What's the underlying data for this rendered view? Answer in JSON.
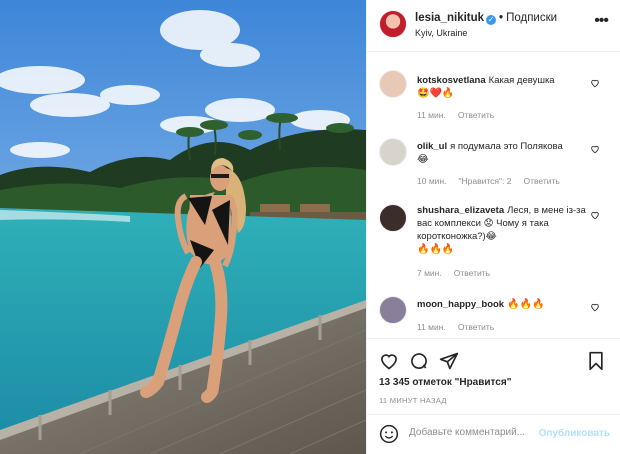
{
  "header": {
    "username": "lesia_nikituk",
    "separator": "•",
    "follow_label": "Подписки",
    "location": "Kyiv, Ukraine",
    "more_label": "•••"
  },
  "comments": [
    {
      "username": "kotskosvetlana",
      "text": "Какая девушка",
      "emojis": "🤩❤️🔥",
      "time": "11 мин.",
      "reply": "Ответить",
      "avatar_color": "#e8c9b6"
    },
    {
      "username": "olik_ul",
      "text": "я подумала это Полякова",
      "emojis": "😂",
      "time": "10 мин.",
      "likes": "\"Нравится\": 2",
      "reply": "Ответить",
      "avatar_color": "#d8d4cc"
    },
    {
      "username": "shushara_elizaveta",
      "text": "Леся, в мене із-за вас комплекси 😟 Чому я така коротконожка?)😂",
      "emojis": "🔥🔥🔥",
      "time": "7 мин.",
      "reply": "Ответить",
      "avatar_color": "#3b2e2a"
    },
    {
      "username": "moon_happy_book",
      "text": "",
      "emojis": "🔥🔥🔥",
      "time": "11 мин.",
      "reply": "Ответить",
      "avatar_color": "#8a7f9a"
    }
  ],
  "stats": {
    "likes": "13 345 отметок \"Нравится\"",
    "time_ago": "11 МИНУТ НАЗАД"
  },
  "add_comment": {
    "placeholder": "Добавьте комментарий...",
    "publish_label": "Опубликовать"
  },
  "colors": {
    "link_blue": "#3897f0",
    "publish_disabled": "#b2dffc",
    "muted_text": "#8e8e8e",
    "verified": "#3897f0"
  }
}
